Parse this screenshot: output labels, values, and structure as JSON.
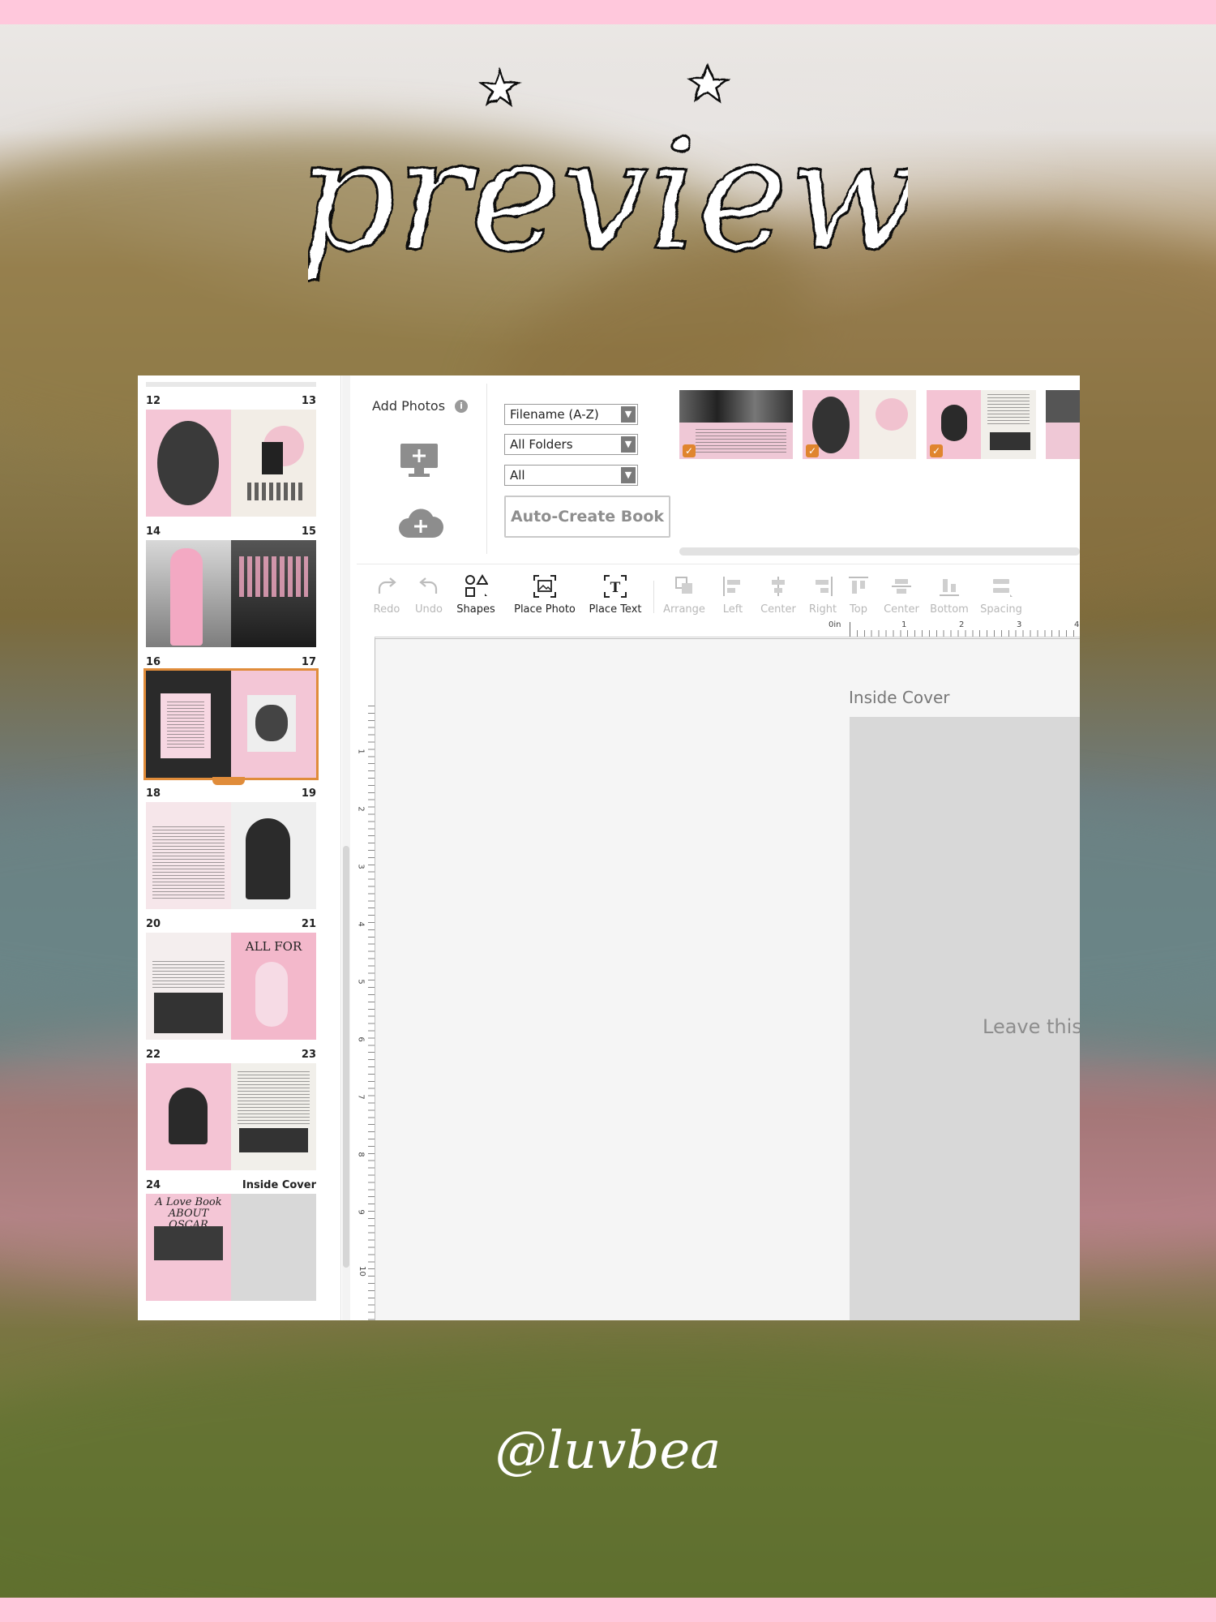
{
  "header": {
    "title": "preview"
  },
  "watermark": "@luvbea",
  "colors": {
    "accent": "#e08c3a",
    "frame": "#ffc8dc",
    "placeholder": "#d8d8d8"
  },
  "sidebar": {
    "spreads": [
      {
        "left": "12",
        "right": "13"
      },
      {
        "left": "14",
        "right": "15"
      },
      {
        "left": "16",
        "right": "17",
        "selected": true
      },
      {
        "left": "18",
        "right": "19"
      },
      {
        "left": "20",
        "right": "21"
      },
      {
        "left": "22",
        "right": "23"
      },
      {
        "left": "24",
        "right": "Inside Cover"
      }
    ],
    "page21_text": "ALL FOR",
    "page24_text": "A Love Book ABOUT OSCAR"
  },
  "add_photos": {
    "label": "Add Photos",
    "info_icon": "i"
  },
  "filters": {
    "sort": "Filename (A-Z)",
    "folders": "All Folders",
    "scope": "All"
  },
  "auto_create_label": "Auto-Create Book",
  "toolbar": {
    "redo": "Redo",
    "undo": "Undo",
    "shapes": "Shapes",
    "place_photo": "Place Photo",
    "place_text": "Place Text",
    "arrange": "Arrange",
    "left": "Left",
    "center": "Center",
    "right": "Right",
    "top": "Top",
    "center2": "Center",
    "bottom": "Bottom",
    "spacing": "Spacing"
  },
  "ruler": {
    "top": [
      "0in",
      "1",
      "2",
      "3",
      "4"
    ],
    "left": [
      "1",
      "2",
      "3",
      "4",
      "5",
      "6",
      "7",
      "8",
      "9",
      "10"
    ]
  },
  "canvas": {
    "page_label": "Inside Cover",
    "placeholder_text": "Leave this"
  }
}
